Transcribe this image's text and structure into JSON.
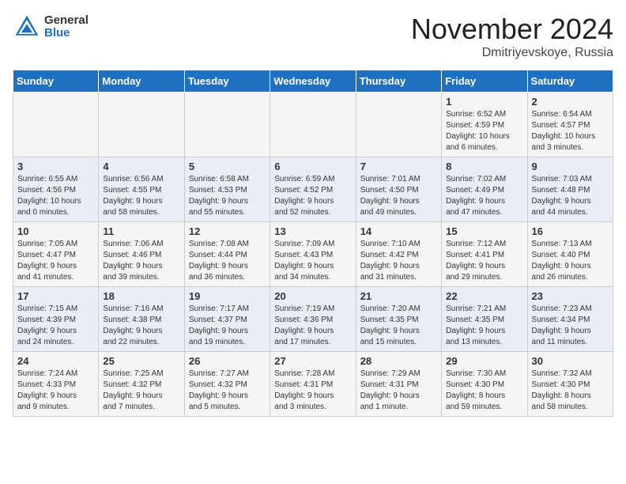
{
  "logo": {
    "general": "General",
    "blue": "Blue"
  },
  "title": {
    "month": "November 2024",
    "location": "Dmitriyevskoye, Russia"
  },
  "headers": [
    "Sunday",
    "Monday",
    "Tuesday",
    "Wednesday",
    "Thursday",
    "Friday",
    "Saturday"
  ],
  "weeks": [
    [
      {
        "day": "",
        "info": ""
      },
      {
        "day": "",
        "info": ""
      },
      {
        "day": "",
        "info": ""
      },
      {
        "day": "",
        "info": ""
      },
      {
        "day": "",
        "info": ""
      },
      {
        "day": "1",
        "info": "Sunrise: 6:52 AM\nSunset: 4:59 PM\nDaylight: 10 hours\nand 6 minutes."
      },
      {
        "day": "2",
        "info": "Sunrise: 6:54 AM\nSunset: 4:57 PM\nDaylight: 10 hours\nand 3 minutes."
      }
    ],
    [
      {
        "day": "3",
        "info": "Sunrise: 6:55 AM\nSunset: 4:56 PM\nDaylight: 10 hours\nand 0 minutes."
      },
      {
        "day": "4",
        "info": "Sunrise: 6:56 AM\nSunset: 4:55 PM\nDaylight: 9 hours\nand 58 minutes."
      },
      {
        "day": "5",
        "info": "Sunrise: 6:58 AM\nSunset: 4:53 PM\nDaylight: 9 hours\nand 55 minutes."
      },
      {
        "day": "6",
        "info": "Sunrise: 6:59 AM\nSunset: 4:52 PM\nDaylight: 9 hours\nand 52 minutes."
      },
      {
        "day": "7",
        "info": "Sunrise: 7:01 AM\nSunset: 4:50 PM\nDaylight: 9 hours\nand 49 minutes."
      },
      {
        "day": "8",
        "info": "Sunrise: 7:02 AM\nSunset: 4:49 PM\nDaylight: 9 hours\nand 47 minutes."
      },
      {
        "day": "9",
        "info": "Sunrise: 7:03 AM\nSunset: 4:48 PM\nDaylight: 9 hours\nand 44 minutes."
      }
    ],
    [
      {
        "day": "10",
        "info": "Sunrise: 7:05 AM\nSunset: 4:47 PM\nDaylight: 9 hours\nand 41 minutes."
      },
      {
        "day": "11",
        "info": "Sunrise: 7:06 AM\nSunset: 4:46 PM\nDaylight: 9 hours\nand 39 minutes."
      },
      {
        "day": "12",
        "info": "Sunrise: 7:08 AM\nSunset: 4:44 PM\nDaylight: 9 hours\nand 36 minutes."
      },
      {
        "day": "13",
        "info": "Sunrise: 7:09 AM\nSunset: 4:43 PM\nDaylight: 9 hours\nand 34 minutes."
      },
      {
        "day": "14",
        "info": "Sunrise: 7:10 AM\nSunset: 4:42 PM\nDaylight: 9 hours\nand 31 minutes."
      },
      {
        "day": "15",
        "info": "Sunrise: 7:12 AM\nSunset: 4:41 PM\nDaylight: 9 hours\nand 29 minutes."
      },
      {
        "day": "16",
        "info": "Sunrise: 7:13 AM\nSunset: 4:40 PM\nDaylight: 9 hours\nand 26 minutes."
      }
    ],
    [
      {
        "day": "17",
        "info": "Sunrise: 7:15 AM\nSunset: 4:39 PM\nDaylight: 9 hours\nand 24 minutes."
      },
      {
        "day": "18",
        "info": "Sunrise: 7:16 AM\nSunset: 4:38 PM\nDaylight: 9 hours\nand 22 minutes."
      },
      {
        "day": "19",
        "info": "Sunrise: 7:17 AM\nSunset: 4:37 PM\nDaylight: 9 hours\nand 19 minutes."
      },
      {
        "day": "20",
        "info": "Sunrise: 7:19 AM\nSunset: 4:36 PM\nDaylight: 9 hours\nand 17 minutes."
      },
      {
        "day": "21",
        "info": "Sunrise: 7:20 AM\nSunset: 4:35 PM\nDaylight: 9 hours\nand 15 minutes."
      },
      {
        "day": "22",
        "info": "Sunrise: 7:21 AM\nSunset: 4:35 PM\nDaylight: 9 hours\nand 13 minutes."
      },
      {
        "day": "23",
        "info": "Sunrise: 7:23 AM\nSunset: 4:34 PM\nDaylight: 9 hours\nand 11 minutes."
      }
    ],
    [
      {
        "day": "24",
        "info": "Sunrise: 7:24 AM\nSunset: 4:33 PM\nDaylight: 9 hours\nand 9 minutes."
      },
      {
        "day": "25",
        "info": "Sunrise: 7:25 AM\nSunset: 4:32 PM\nDaylight: 9 hours\nand 7 minutes."
      },
      {
        "day": "26",
        "info": "Sunrise: 7:27 AM\nSunset: 4:32 PM\nDaylight: 9 hours\nand 5 minutes."
      },
      {
        "day": "27",
        "info": "Sunrise: 7:28 AM\nSunset: 4:31 PM\nDaylight: 9 hours\nand 3 minutes."
      },
      {
        "day": "28",
        "info": "Sunrise: 7:29 AM\nSunset: 4:31 PM\nDaylight: 9 hours\nand 1 minute."
      },
      {
        "day": "29",
        "info": "Sunrise: 7:30 AM\nSunset: 4:30 PM\nDaylight: 8 hours\nand 59 minutes."
      },
      {
        "day": "30",
        "info": "Sunrise: 7:32 AM\nSunset: 4:30 PM\nDaylight: 8 hours\nand 58 minutes."
      }
    ]
  ]
}
